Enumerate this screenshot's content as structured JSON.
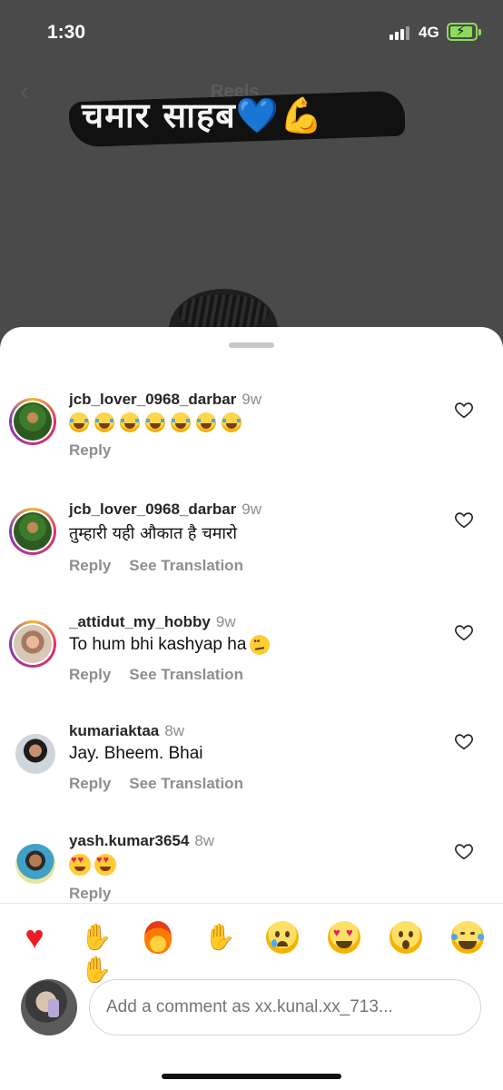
{
  "status_bar": {
    "time": "1:30",
    "network": "4G",
    "battery_state": "charging"
  },
  "background": {
    "page_title": "Reels",
    "banner_text": "चमार साहब",
    "banner_emoji": "💙💪"
  },
  "comments": [
    {
      "username": "jcb_lover_0968_darbar",
      "age": "9w",
      "text": "😂😂😂😂😂😂😂",
      "reply_label": "Reply",
      "see_translation_label": "",
      "has_story_ring": true
    },
    {
      "username": "jcb_lover_0968_darbar",
      "age": "9w",
      "text": "तुम्हारी यही औकात है चमारो",
      "reply_label": "Reply",
      "see_translation_label": "See Translation",
      "has_story_ring": true
    },
    {
      "username": "_attidut_my_hobby",
      "age": "9w",
      "text": "To hum bhi kashyap ha",
      "text_emoji": "🤨",
      "reply_label": "Reply",
      "see_translation_label": "See Translation",
      "has_story_ring": true
    },
    {
      "username": "kumariaktaa",
      "age": "8w",
      "text": "Jay. Bheem. Bhai",
      "reply_label": "Reply",
      "see_translation_label": "See Translation",
      "has_story_ring": false
    },
    {
      "username": "yash.kumar3654",
      "age": "8w",
      "text": "😍😍",
      "reply_label": "Reply",
      "see_translation_label": "",
      "has_story_ring": false
    }
  ],
  "reaction_bar": [
    "red-heart",
    "raising-hands",
    "fire",
    "clapping-hands",
    "crying-face",
    "heart-eyes-face",
    "surprised-face",
    "tears-of-joy-face"
  ],
  "composer": {
    "placeholder": "Add a comment as xx.kunal.xx_713..."
  },
  "colors": {
    "like_heart": "#ed1c24",
    "secondary_text": "#8e8e8e",
    "battery": "#8bdc5a"
  }
}
